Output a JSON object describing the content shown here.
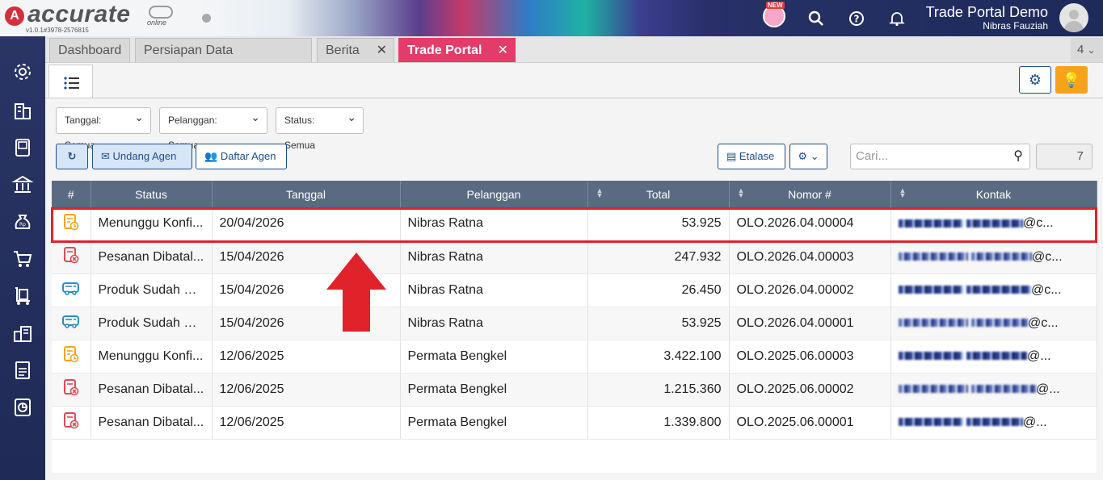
{
  "app": {
    "logo_text": "accurate",
    "logo_sub": "online",
    "version": "v1.0.1#3978-2576815",
    "new_badge": "NEW",
    "company": "Trade Portal Demo",
    "user": "Nibras Fauziah"
  },
  "tabs": [
    {
      "label": "Dashboard",
      "active": false,
      "closable": false
    },
    {
      "label": "Persiapan Data Perusahaan",
      "active": false,
      "closable": false
    },
    {
      "label": "Berita",
      "active": false,
      "closable": true
    },
    {
      "label": "Trade Portal",
      "active": true,
      "closable": true
    }
  ],
  "tab_count": "4",
  "filters": {
    "tanggal": "Tanggal: Semua",
    "pelanggan": "Pelanggan: Semua",
    "status": "Status: Semua"
  },
  "toolbar": {
    "undang_agen": "Undang Agen",
    "daftar_agen": "Daftar Agen",
    "etalase": "Etalase",
    "search_placeholder": "Cari...",
    "record_count": "7"
  },
  "table": {
    "headers": [
      "#",
      "Status",
      "Tanggal",
      "Pelanggan",
      "Total",
      "Nomor #",
      "Kontak"
    ],
    "rows": [
      {
        "icon": "pending-order-icon",
        "status": "Menunggu Konfi...",
        "tanggal": "20/04/2026",
        "pelanggan": "Nibras Ratna",
        "total": "53.925",
        "nomor": "OLO.2026.04.00004",
        "kontak_suffix": "@c..."
      },
      {
        "icon": "cancelled-order-icon",
        "status": "Pesanan Dibatal...",
        "tanggal": "15/04/2026",
        "pelanggan": "Nibras Ratna",
        "total": "247.932",
        "nomor": "OLO.2026.04.00003",
        "kontak_suffix": "@c..."
      },
      {
        "icon": "delivery-truck-icon",
        "status": "Produk Sudah Ki...",
        "tanggal": "15/04/2026",
        "pelanggan": "Nibras Ratna",
        "total": "26.450",
        "nomor": "OLO.2026.04.00002",
        "kontak_suffix": "@c..."
      },
      {
        "icon": "delivery-truck-icon",
        "status": "Produk Sudah Ki...",
        "tanggal": "15/04/2026",
        "pelanggan": "Nibras Ratna",
        "total": "53.925",
        "nomor": "OLO.2026.04.00001",
        "kontak_suffix": "@c..."
      },
      {
        "icon": "pending-order-icon",
        "status": "Menunggu Konfi...",
        "tanggal": "12/06/2025",
        "pelanggan": "Permata Bengkel",
        "total": "3.422.100",
        "nomor": "OLO.2025.06.00003",
        "kontak_suffix": "@..."
      },
      {
        "icon": "cancelled-order-icon",
        "status": "Pesanan Dibatal...",
        "tanggal": "12/06/2025",
        "pelanggan": "Permata Bengkel",
        "total": "1.215.360",
        "nomor": "OLO.2025.06.00002",
        "kontak_suffix": "@..."
      },
      {
        "icon": "cancelled-order-icon",
        "status": "Pesanan Dibatal...",
        "tanggal": "12/06/2025",
        "pelanggan": "Permata Bengkel",
        "total": "1.339.800",
        "nomor": "OLO.2025.06.00001",
        "kontak_suffix": "@..."
      }
    ]
  },
  "colors": {
    "accent_tab": "#e43c68",
    "primary": "#1e4e8c",
    "header": "#5a6a82",
    "pending": "#f6a31b",
    "cancelled": "#e04a55",
    "shipped": "#2b8bc9",
    "highlight": "#e0222a"
  }
}
